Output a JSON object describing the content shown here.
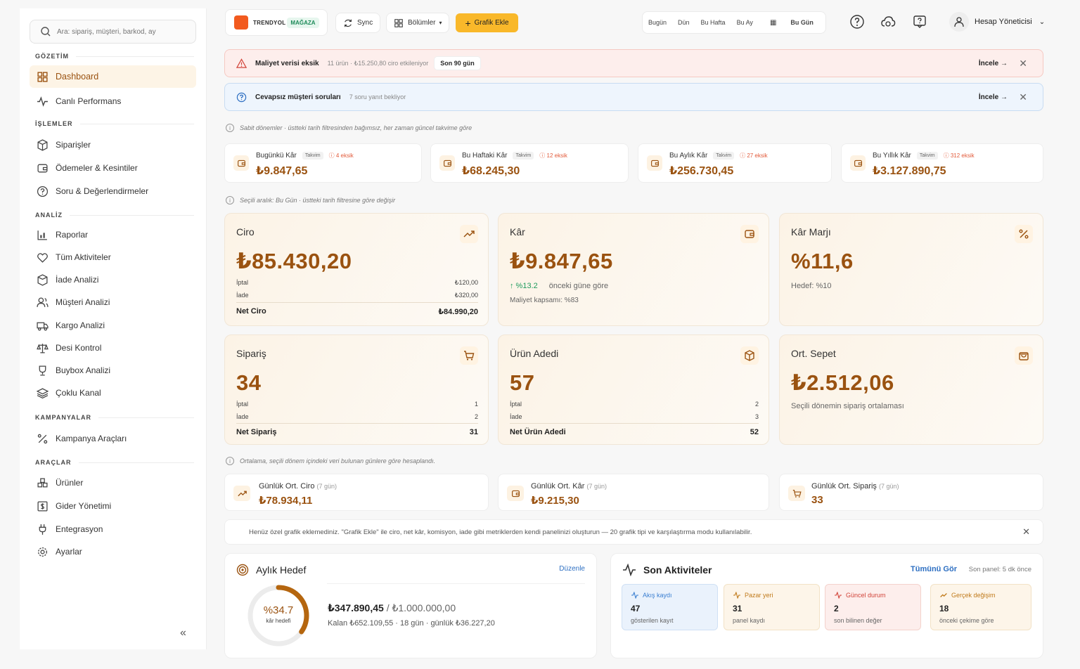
{
  "sidebar": {
    "search_placeholder": "Ara: sipariş, müşteri, barkod, ay",
    "sections": {
      "gozetim": "GÖZETİM",
      "islemler": "İŞLEMLER",
      "analiz": "ANALİZ",
      "kampanyalar": "KAMPANYALAR",
      "araclar": "ARAÇLAR"
    },
    "items": {
      "dashboard": "Dashboard",
      "canli": "Canlı Performans",
      "siparisler": "Siparişler",
      "odemeler": "Ödemeler & Kesintiler",
      "soru": "Soru & Değerlendirmeler",
      "raporlar": "Raporlar",
      "tum_aktiviteler": "Tüm Aktiviteler",
      "iade_analizi": "İade Analizi",
      "musteri_analizi": "Müşteri Analizi",
      "kargo_analizi": "Kargo Analizi",
      "desi_kontrol": "Desi Kontrol",
      "buybox": "Buybox Analizi",
      "coklu_kanal": "Çoklu Kanal",
      "kampanya": "Kampanya Araçları",
      "urunler": "Ürünler",
      "gider": "Gider Yönetimi",
      "entegrasyon": "Entegrasyon",
      "ayarlar": "Ayarlar"
    },
    "collapse": "«"
  },
  "topbar": {
    "brand_name": "TRENDYOL",
    "brand_tag": "MAĞAZA",
    "sync": "Sync",
    "sections": "Bölümler",
    "add_chart": "Grafik Ekle",
    "periods": [
      "Bugün",
      "Dün",
      "Bu Hafta",
      "Bu Ay",
      "Bu Gün"
    ],
    "user": "Hesap Yöneticisi"
  },
  "alerts": {
    "cost": {
      "title": "Maliyet verisi eksik",
      "desc": "11 ürün · ₺15.250,80 ciro etkileniyor",
      "chip": "Son 90 gün",
      "action": "İncele →"
    },
    "questions": {
      "title": "Cevapsız müşteri soruları",
      "desc": "7 soru yanıt bekliyor",
      "action": "İncele →"
    }
  },
  "notes": {
    "fixed": "Sabit dönemler · üstteki tarih filtresinden bağımsız, her zaman güncel takvime göre",
    "selected": "Seçili aralık: Bu Gün · üstteki tarih filtresine göre değişir",
    "avg": "Ortalama, seçili dönem içindeki veri bulunan günlere göre hesaplandı."
  },
  "period_cards": [
    {
      "label": "Bugünkü Kâr",
      "tag": "Takvim",
      "missing": "4 eksik",
      "value": "₺9.847,65"
    },
    {
      "label": "Bu Haftaki Kâr",
      "tag": "Takvim",
      "missing": "12 eksik",
      "value": "₺68.245,30"
    },
    {
      "label": "Bu Aylık Kâr",
      "tag": "Takvim",
      "missing": "27 eksik",
      "value": "₺256.730,45"
    },
    {
      "label": "Bu Yıllık Kâr",
      "tag": "Takvim",
      "missing": "312 eksik",
      "value": "₺3.127.890,75"
    }
  ],
  "ciro": {
    "title": "Ciro",
    "value": "₺85.430,20",
    "iptal_label": "İptal",
    "iptal": "₺120,00",
    "iade_label": "İade",
    "iade": "₺320,00",
    "net_label": "Net Ciro",
    "net": "₺84.990,20"
  },
  "kar": {
    "title": "Kâr",
    "value": "₺9.847,65",
    "change": "↑ %13.2",
    "change_desc": "önceki güne göre",
    "coverage": "Maliyet kapsamı: %83"
  },
  "marj": {
    "title": "Kâr Marjı",
    "value": "%11,6",
    "target": "Hedef: %10"
  },
  "siparis": {
    "title": "Sipariş",
    "value": "34",
    "iptal_label": "İptal",
    "iptal": "1",
    "iade_label": "İade",
    "iade": "2",
    "net_label": "Net Sipariş",
    "net": "31"
  },
  "urun": {
    "title": "Ürün Adedi",
    "value": "57",
    "iptal_label": "İptal",
    "iptal": "2",
    "iade_label": "İade",
    "iade": "3",
    "net_label": "Net Ürün Adedi",
    "net": "52"
  },
  "sepet": {
    "title": "Ort. Sepet",
    "value": "₺2.512,06",
    "desc": "Seçili dönemin sipariş ortalaması"
  },
  "avg_cards": [
    {
      "label": "Günlük Ort. Ciro",
      "days": "(7 gün)",
      "value": "₺78.934,11"
    },
    {
      "label": "Günlük Ort. Kâr",
      "days": "(7 gün)",
      "value": "₺9.215,30"
    },
    {
      "label": "Günlük Ort. Sipariş",
      "days": "(7 gün)",
      "value": "33"
    }
  ],
  "info_bar": "Henüz özel grafik eklemediniz. \"Grafik Ekle\" ile ciro, net kâr, komisyon, iade gibi metriklerden kendi panelinizi oluşturun — 20 grafik tipi ve karşılaştırma modu kullanılabilir.",
  "goal": {
    "title": "Aylık Hedef",
    "edit": "Düzenle",
    "percent": "%34.7",
    "percent_value": 0.347,
    "percent_label": "kâr hedefi",
    "current": "₺347.890,45",
    "target": "/ ₺1.000.000,00",
    "remaining": "Kalan ₺652.109,55 · 18 gün · günlük ₺36.227,20"
  },
  "activities": {
    "title": "Son Aktiviteler",
    "all": "Tümünü Gör",
    "last_panel": "Son panel: 5 dk önce",
    "cards": [
      {
        "title": "Akış kaydı",
        "value": "47",
        "desc": "gösterilen kayıt",
        "color": "#3b7fd1"
      },
      {
        "title": "Pazar yeri",
        "value": "31",
        "desc": "panel kaydı",
        "color": "#c07a1a"
      },
      {
        "title": "Güncel durum",
        "value": "2",
        "desc": "son bilinen değer",
        "color": "#d2443a"
      },
      {
        "title": "Gerçek değişim",
        "value": "18",
        "desc": "önceki çekime göre",
        "color": "#c07a1a"
      }
    ]
  },
  "colors": {
    "accent": "#9a5210",
    "primary_button": "#f9b82a",
    "brand": "#f25a1e"
  }
}
